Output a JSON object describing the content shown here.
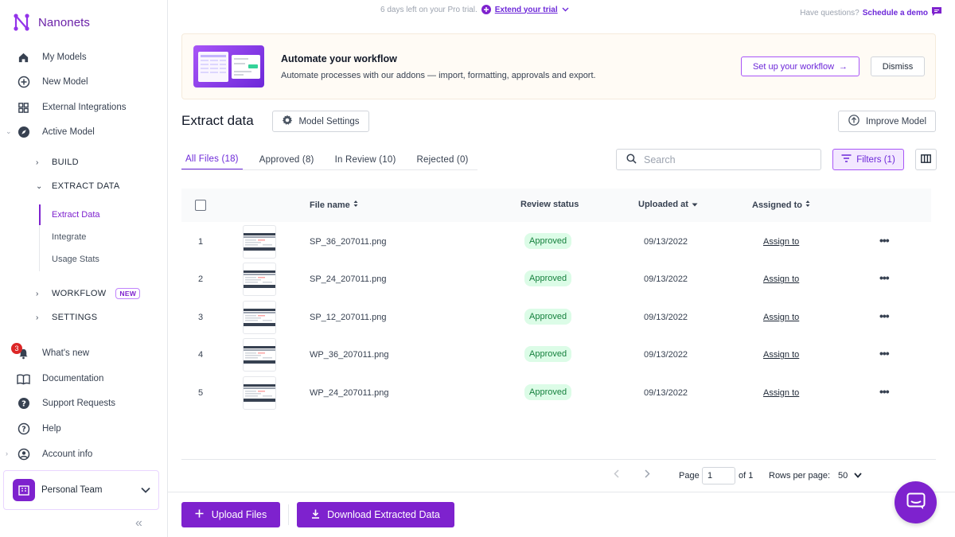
{
  "brand": {
    "name": "Nanonets"
  },
  "trial": {
    "text": "6 days left on your Pro trial.",
    "extend": "Extend your trial"
  },
  "help": {
    "question": "Have questions?",
    "demo": "Schedule a demo"
  },
  "sidebar": {
    "top_items": [
      {
        "label": "My Models",
        "icon": "home-icon"
      },
      {
        "label": "New Model",
        "icon": "plus-circle-icon"
      },
      {
        "label": "External Integrations",
        "icon": "grid-icon"
      },
      {
        "label": "Active Model",
        "icon": "compass-icon"
      }
    ],
    "sections": [
      {
        "label": "BUILD"
      },
      {
        "label": "EXTRACT DATA"
      },
      {
        "label": "WORKFLOW",
        "badge": "NEW"
      },
      {
        "label": "SETTINGS"
      }
    ],
    "extract_leaves": [
      {
        "label": "Extract Data",
        "active": true
      },
      {
        "label": "Integrate"
      },
      {
        "label": "Usage Stats"
      }
    ],
    "bottom_items": [
      {
        "label": "What's new",
        "icon": "bell-icon",
        "badge": "3"
      },
      {
        "label": "Documentation",
        "icon": "book-icon"
      },
      {
        "label": "Support Requests",
        "icon": "help-circle-icon"
      },
      {
        "label": "Help",
        "icon": "question-icon"
      },
      {
        "label": "Account info",
        "icon": "account-icon"
      }
    ],
    "team": "Personal Team"
  },
  "banner": {
    "title": "Automate your workflow",
    "description": "Automate processes with our addons — import, formatting, approvals and export.",
    "setup_label": "Set up your workflow",
    "dismiss_label": "Dismiss"
  },
  "header": {
    "title": "Extract data",
    "settings_label": "Model Settings",
    "improve_label": "Improve Model"
  },
  "tabs": [
    {
      "label": "All Files (18)",
      "active": true
    },
    {
      "label": "Approved (8)"
    },
    {
      "label": "In Review (10)"
    },
    {
      "label": "Rejected (0)"
    }
  ],
  "search": {
    "placeholder": "Search"
  },
  "filters_label": "Filters (1)",
  "table": {
    "columns": [
      "File name",
      "Review status",
      "Uploaded at",
      "Assigned to"
    ],
    "rows": [
      {
        "num": "1",
        "file": "SP_36_207011.png",
        "status": "Approved",
        "date": "09/13/2022",
        "assign": "Assign to"
      },
      {
        "num": "2",
        "file": "SP_24_207011.png",
        "status": "Approved",
        "date": "09/13/2022",
        "assign": "Assign to"
      },
      {
        "num": "3",
        "file": "SP_12_207011.png",
        "status": "Approved",
        "date": "09/13/2022",
        "assign": "Assign to"
      },
      {
        "num": "4",
        "file": "WP_36_207011.png",
        "status": "Approved",
        "date": "09/13/2022",
        "assign": "Assign to"
      },
      {
        "num": "5",
        "file": "WP_24_207011.png",
        "status": "Approved",
        "date": "09/13/2022",
        "assign": "Assign to"
      }
    ]
  },
  "pagination": {
    "page_label": "Page",
    "page_value": "1",
    "of_label": "of 1",
    "rows_label": "Rows per page:",
    "rows_value": "50"
  },
  "footer": {
    "upload_label": "Upload Files",
    "download_label": "Download Extracted Data"
  },
  "colors": {
    "accent": "#7e22ce",
    "approved_bg": "#dcfce7",
    "approved_text": "#15803d"
  }
}
